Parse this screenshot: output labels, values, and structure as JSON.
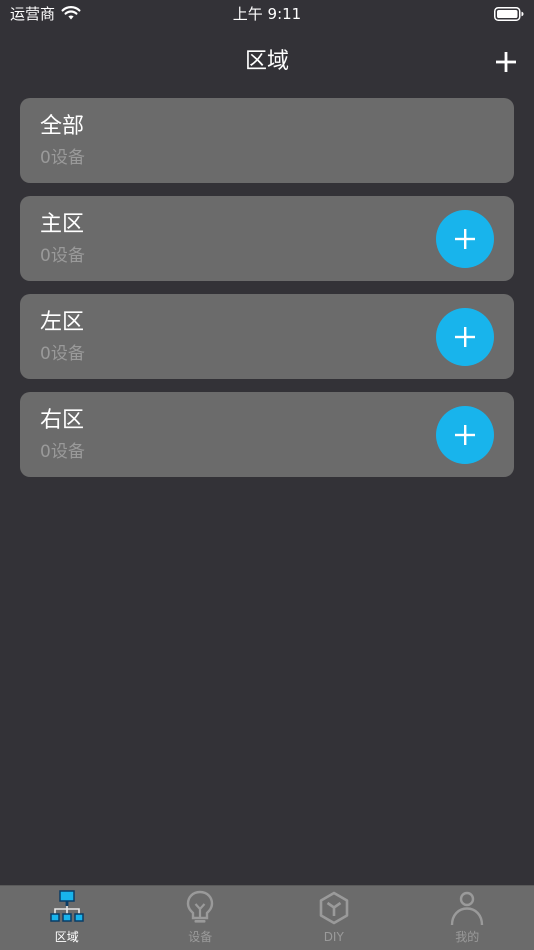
{
  "status_bar": {
    "carrier": "运营商",
    "time": "上午 9:11"
  },
  "nav": {
    "title": "区域"
  },
  "areas": [
    {
      "name": "全部",
      "count": "0设备",
      "has_add": false
    },
    {
      "name": "主区",
      "count": "0设备",
      "has_add": true
    },
    {
      "name": "左区",
      "count": "0设备",
      "has_add": true
    },
    {
      "name": "右区",
      "count": "0设备",
      "has_add": true
    }
  ],
  "tabs": [
    {
      "label": "区域",
      "icon": "network-icon",
      "active": true
    },
    {
      "label": "设备",
      "icon": "lightbulb-icon",
      "active": false
    },
    {
      "label": "DIY",
      "icon": "cube-icon",
      "active": false
    },
    {
      "label": "我的",
      "icon": "person-icon",
      "active": false
    }
  ],
  "colors": {
    "background": "#333237",
    "card": "#6b6b6b",
    "accent": "#18b4ec",
    "muted_text": "#9a9a9a"
  }
}
